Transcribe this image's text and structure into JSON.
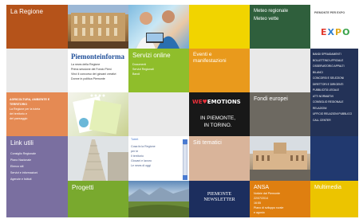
{
  "tiles": {
    "regione": {
      "title": "La Regione"
    },
    "meteo": {
      "line1": "Meteo regionale",
      "line2": "Meteo vette"
    },
    "expo": {
      "header": "PIEMONTE PER EXPO",
      "word": "EXPO"
    },
    "informa": {
      "title": "Piemonteinforma",
      "lines": [
        "La news della Regione",
        "Prima sessione del Fondo Pieni",
        "Vinci il concorso dei giovani creativi",
        "Donne in politica Piemonte"
      ]
    },
    "servizi": {
      "title": "Servizi online",
      "lines": [
        "Documenti",
        "Servizi Regionali",
        "Bandi"
      ]
    },
    "eventi": {
      "title": "Eventi e manifestazioni"
    },
    "navy_list": {
      "items": [
        "BANDI SPRAIDAMENTI",
        "BOLLETTINO UFFICIALE",
        "OSSERVATORIO APPALTI",
        "BILANCI",
        "CONCORSI E SELEZIONI",
        "DIRETTORI E DIRIGENTI",
        "PUBBLICITÀ LEGALE",
        "ATTI NORMATIVI",
        "CONSIGLIO REGIONALE",
        "RELAZIONI",
        "UFFICIO RELAZIONI PUBBLICO",
        "CALL CENTER"
      ]
    },
    "peach": {
      "title": "AGRICOLTURA, AMBIENTE E TERRITORIO",
      "lines": [
        "La Regione per la tutela",
        "del territorio e",
        "del paesaggio"
      ]
    },
    "emotions": {
      "line1": "WE EMOTIONS",
      "line2": "IN PIEMONTE,",
      "line3": "IN TORINO."
    },
    "fondi": {
      "title": "Fondi europei"
    },
    "linkutili": {
      "title": "Link utili",
      "lines": [
        "Consiglio Regionale",
        "Piano Nazionale",
        "Elenco siti",
        "Servizi e informazioni",
        "Agenzie e Istituti"
      ]
    },
    "scroll": {
      "header": "Tweet",
      "lines": [
        "Cosa fa la Regione",
        "per te",
        "Il territorio",
        "Giovani e lavoro",
        "Le news di oggi"
      ]
    },
    "siti": {
      "title": "Siti tematici"
    },
    "progetti": {
      "title": "Progetti"
    },
    "newsletter": {
      "line1": "PIEMONTE",
      "line2": "NEWSLETTER"
    },
    "ansa": {
      "title": "ANSA",
      "lines": [
        "Notizie dal Piemonte",
        "22/07/2014",
        "16:55",
        "Piano di sviluppo rurale",
        "e agosto"
      ]
    },
    "multimedia": {
      "title": "Multimedia"
    }
  },
  "colors": {
    "regione": "#b5531a",
    "yellow": "#f1d400",
    "meteo": "#2f5f3c",
    "servizi": "#8fbe2b",
    "eventi": "#e99a1c",
    "navy": "#233257",
    "peach": "#e58a53",
    "fondi": "#6d6961",
    "linkutili": "#7a6fa0",
    "siti": "#d9b49a",
    "blue": "#21396f",
    "progetti": "#79a92e",
    "ansa": "#df7f10",
    "multimedia": "#ecc400"
  }
}
